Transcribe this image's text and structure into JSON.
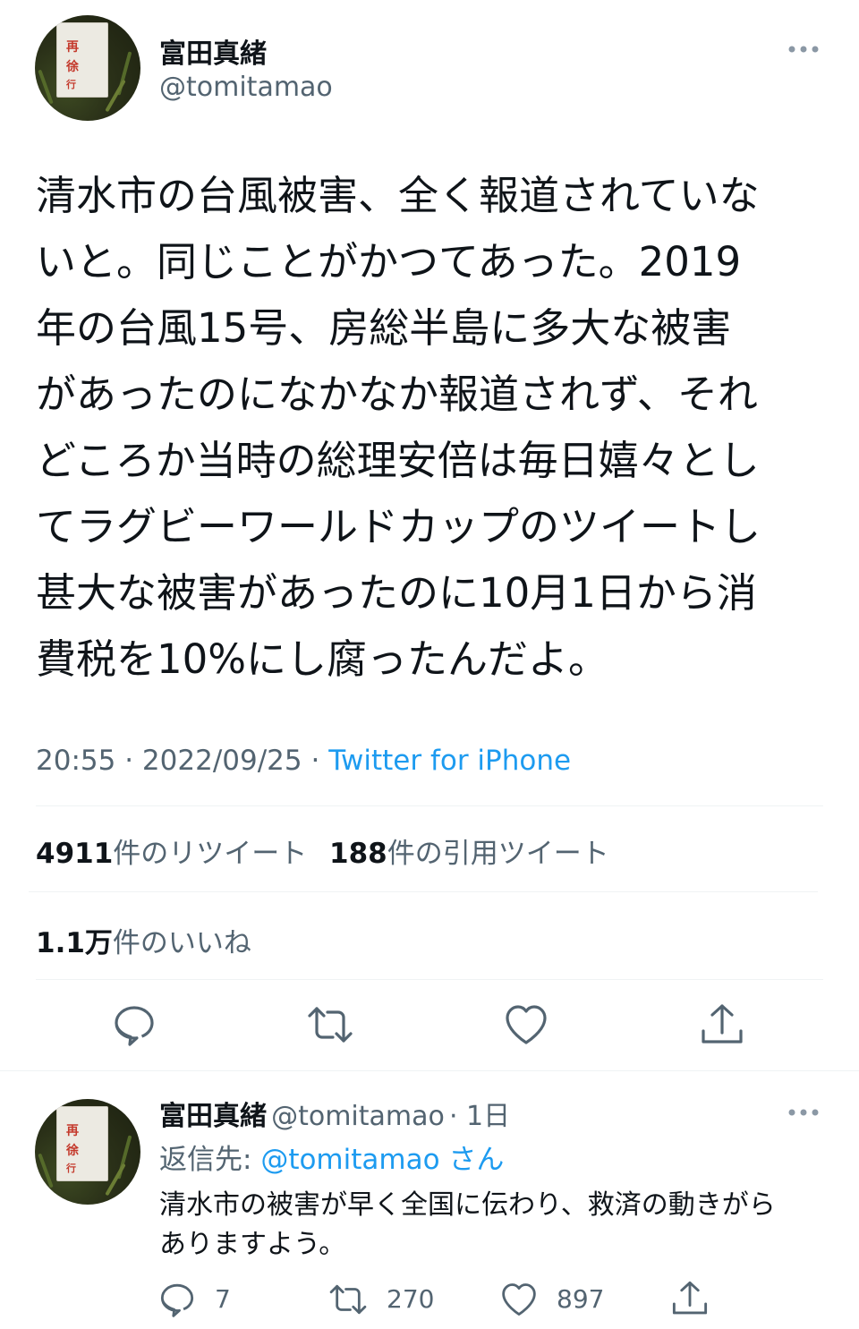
{
  "tweet": {
    "author_name": "富田真緒",
    "author_handle": "@tomitamao",
    "more_icon": "ellipsis-icon",
    "text_lines": [
      "清水市の台風被害、全く報道されていな",
      "いと。同じことがかつてあった。2019",
      "年の台風15号、房総半島に多大な被害",
      "があったのになかなか報道されず、それ",
      "どころか当時の総理安倍は毎日嬉々とし",
      "てラグビーワールドカップのツイートし",
      "甚大な被害があったのに10月1日から消",
      "費税を10%にし腐ったんだよ。"
    ],
    "time": "20:55",
    "separator": "·",
    "date": "2022/09/25",
    "source": "Twitter for iPhone",
    "retweets_count": "4911",
    "retweets_label": "件のリツイート",
    "quotes_count": "188",
    "quotes_label": "件の引用ツイート",
    "likes_count": "1.1万",
    "likes_label": "件のいいね",
    "actions": [
      "reply-icon",
      "retweet-icon",
      "like-icon",
      "share-icon"
    ]
  },
  "reply": {
    "author_name": "富田真緒",
    "author_handle": "@tomitamao",
    "age": "· 1日",
    "replying_label": "返信先:",
    "replying_handle": "@tomitamao",
    "replying_suffix": "さん",
    "text_lines": [
      "清水市の被害が早く全国に伝わり、救済の動きがら",
      "ありますよう。"
    ],
    "reply_count": "7",
    "retweet_count": "270",
    "like_count": "897"
  },
  "avatar_sign_chars": [
    "再",
    "徐",
    "行"
  ],
  "colors": {
    "accent": "#1d9bf0",
    "secondary_text": "#536471",
    "sign_red": "#c43a2c"
  }
}
